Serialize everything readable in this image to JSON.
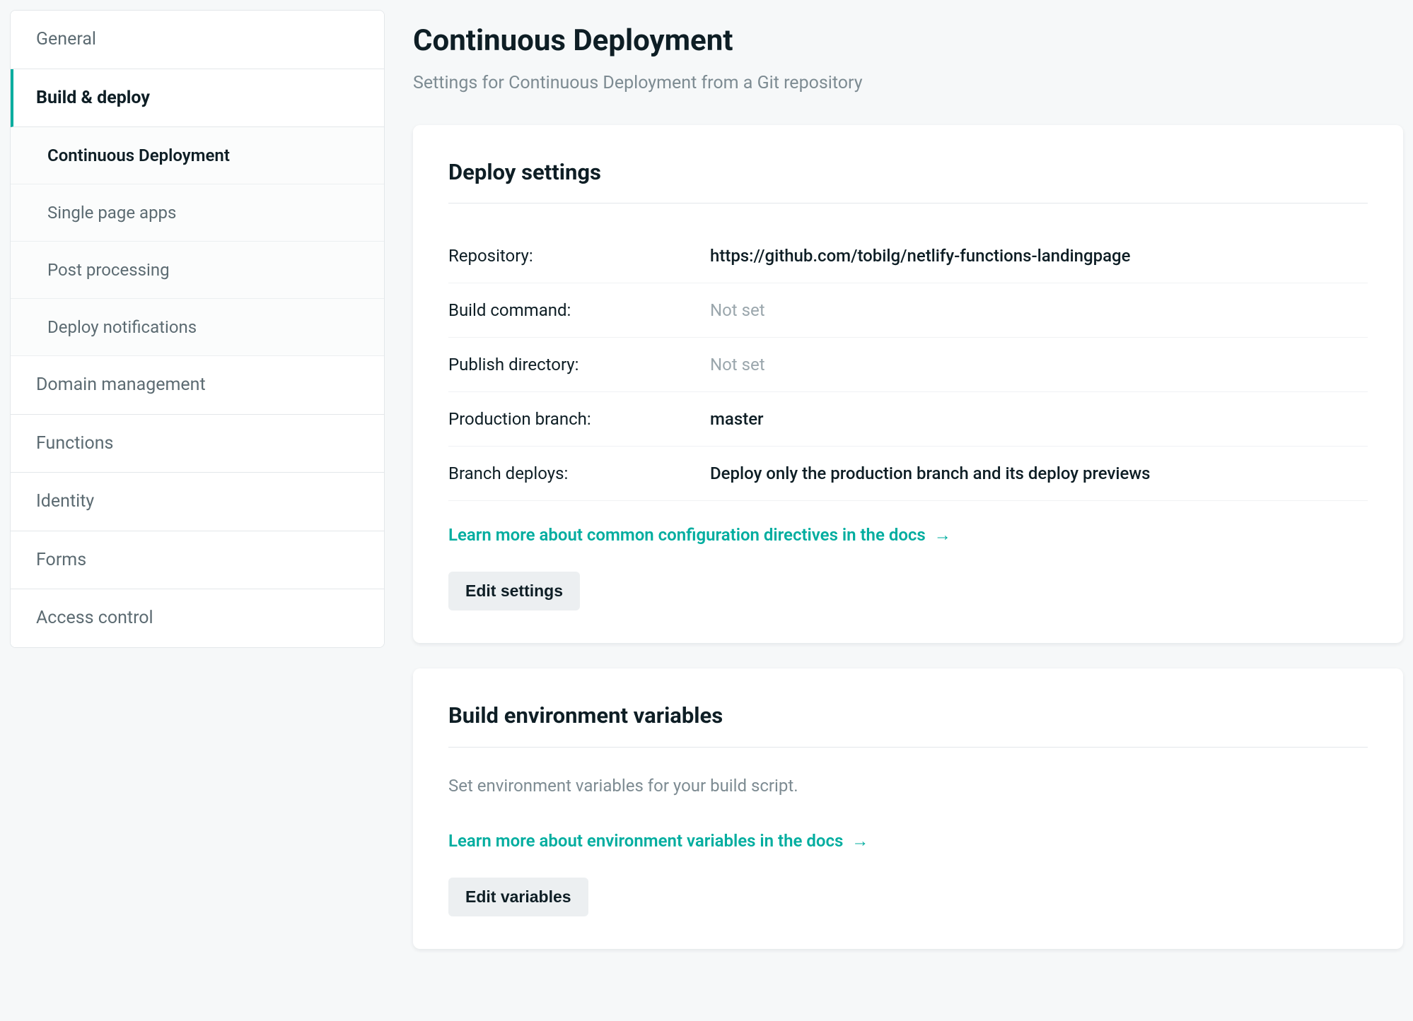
{
  "sidebar": {
    "items": [
      {
        "label": "General",
        "active": false
      },
      {
        "label": "Build & deploy",
        "active": true,
        "subitems": [
          {
            "label": "Continuous Deployment",
            "active": true
          },
          {
            "label": "Single page apps",
            "active": false
          },
          {
            "label": "Post processing",
            "active": false
          },
          {
            "label": "Deploy notifications",
            "active": false
          }
        ]
      },
      {
        "label": "Domain management",
        "active": false
      },
      {
        "label": "Functions",
        "active": false
      },
      {
        "label": "Identity",
        "active": false
      },
      {
        "label": "Forms",
        "active": false
      },
      {
        "label": "Access control",
        "active": false
      }
    ]
  },
  "page": {
    "title": "Continuous Deployment",
    "subtitle": "Settings for Continuous Deployment from a Git repository"
  },
  "deploy_settings": {
    "title": "Deploy settings",
    "rows": {
      "repository_label": "Repository:",
      "repository_value": "https://github.com/tobilg/netlify-functions-landingpage",
      "build_command_label": "Build command:",
      "build_command_value": "Not set",
      "publish_directory_label": "Publish directory:",
      "publish_directory_value": "Not set",
      "production_branch_label": "Production branch:",
      "production_branch_value": "master",
      "branch_deploys_label": "Branch deploys:",
      "branch_deploys_value": "Deploy only the production branch and its deploy previews"
    },
    "learn_link": "Learn more about common configuration directives in the docs",
    "arrow": "→",
    "button": "Edit settings"
  },
  "env_vars": {
    "title": "Build environment variables",
    "desc": "Set environment variables for your build script.",
    "learn_link": "Learn more about environment variables in the docs",
    "arrow": "→",
    "button": "Edit variables"
  }
}
